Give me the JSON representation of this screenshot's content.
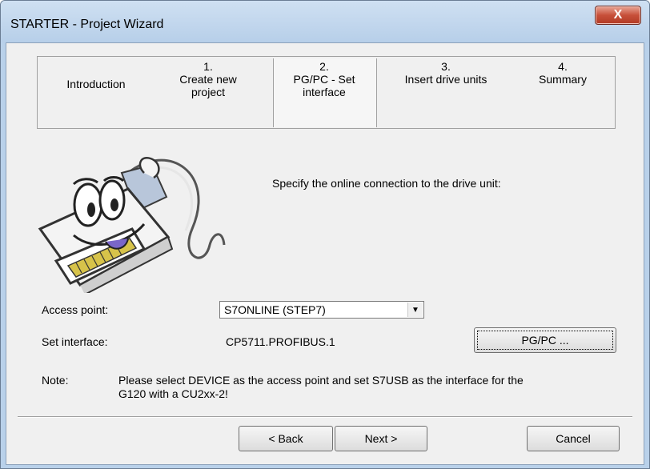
{
  "window": {
    "title": "STARTER - Project Wizard",
    "close_label": "X"
  },
  "steps": [
    {
      "num": "",
      "label": "Introduction",
      "active": false
    },
    {
      "num": "1.",
      "label": "Create new project",
      "active": false
    },
    {
      "num": "2.",
      "label": "PG/PC - Set interface",
      "active": true
    },
    {
      "num": "3.",
      "label": "Insert drive units",
      "active": false
    },
    {
      "num": "4.",
      "label": "Summary",
      "active": false
    }
  ],
  "main": {
    "instruction": "Specify the online connection to the drive unit:",
    "access_point_label": "Access point:",
    "access_point_value": "S7ONLINE (STEP7)",
    "set_interface_label": "Set interface:",
    "set_interface_value": "CP5711.PROFIBUS.1",
    "pgpc_button": "PG/PC ...",
    "note_label": "Note:",
    "note_text": "Please select DEVICE as the access point and set S7USB as the interface for the G120 with a CU2xx-2!"
  },
  "buttons": {
    "back": "< Back",
    "next": "Next >",
    "cancel": "Cancel"
  },
  "icons": {
    "mascot": "cable-connector-mascot-icon",
    "dropdown": "chevron-down-icon",
    "close": "close-icon"
  }
}
